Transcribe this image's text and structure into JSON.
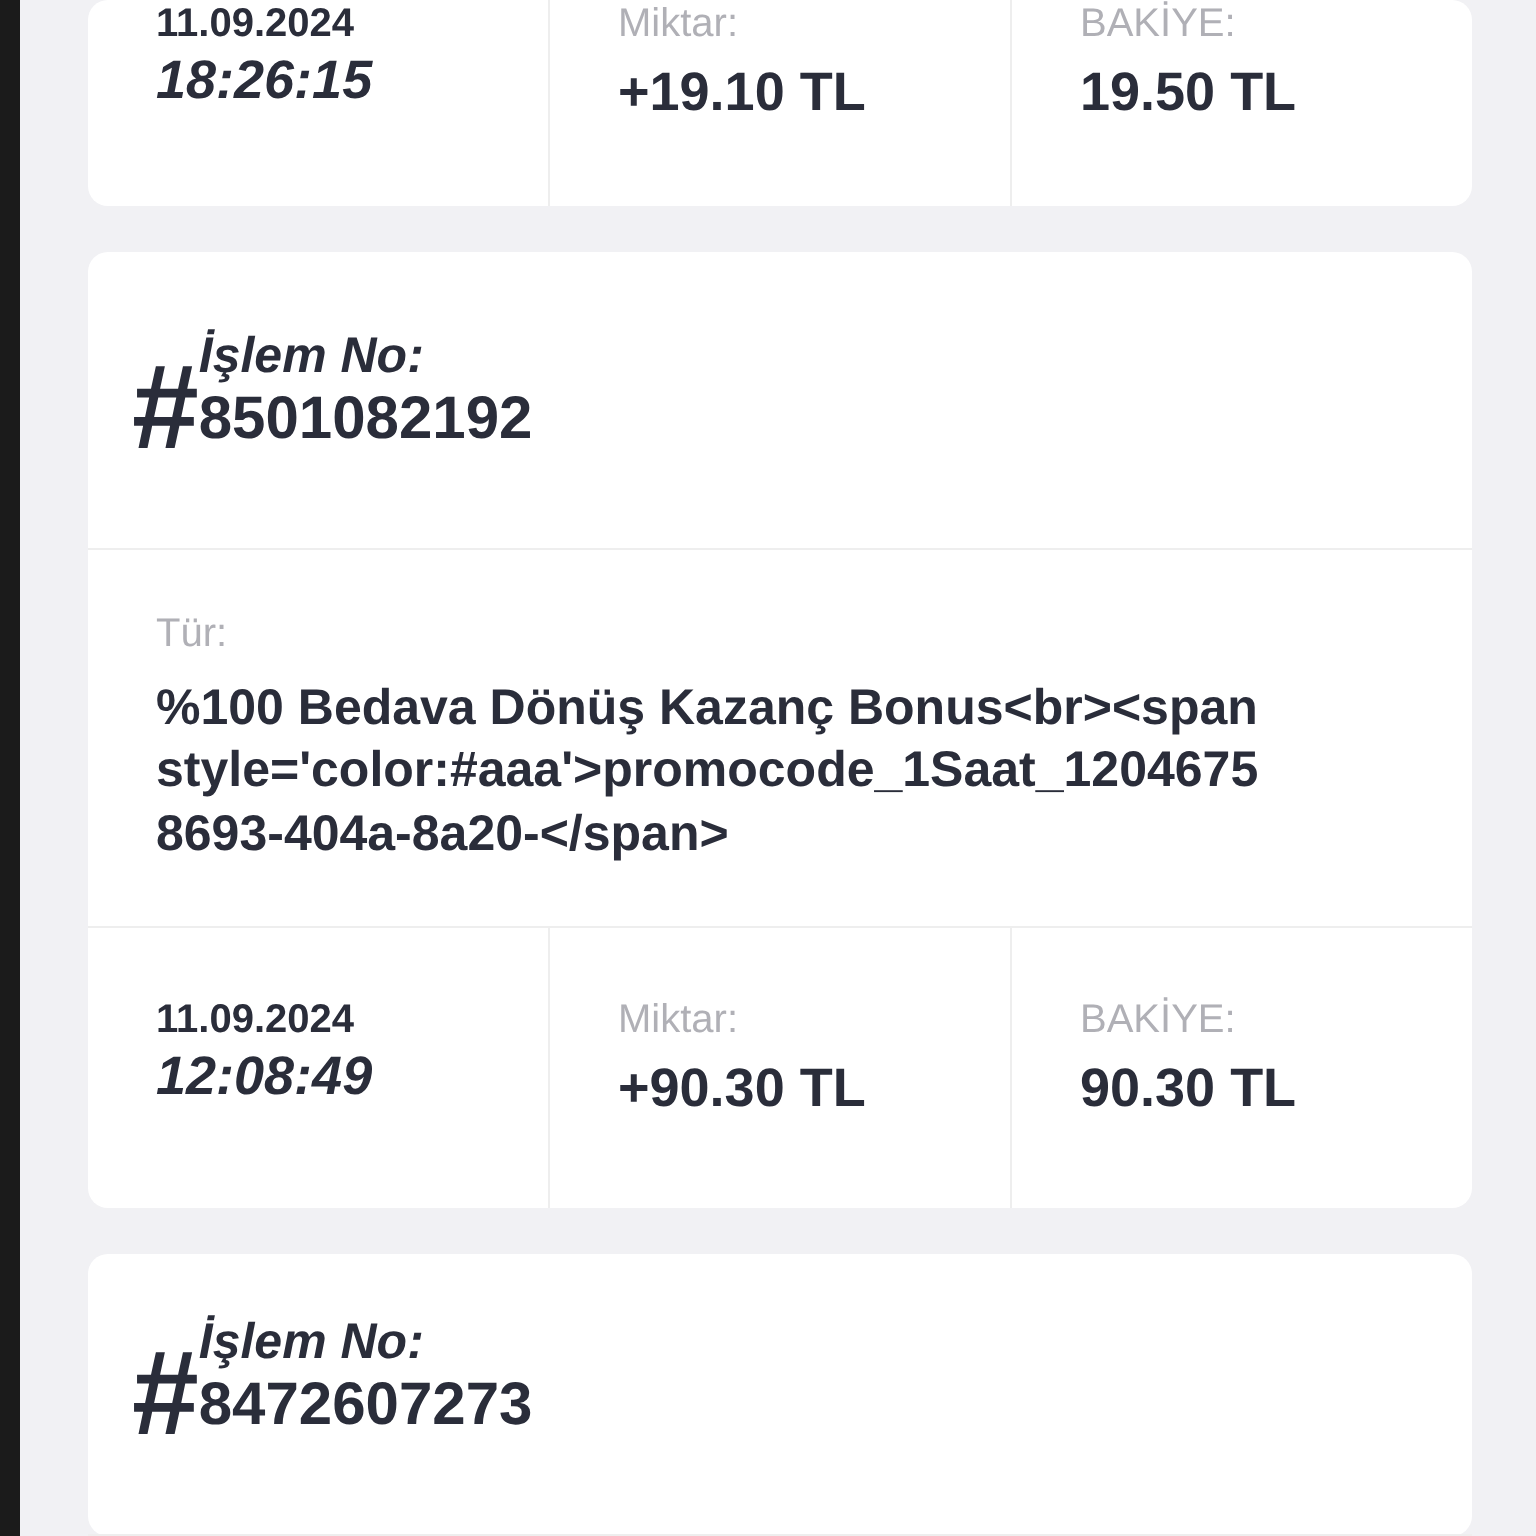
{
  "cards": [
    {
      "date": "11.09.2024",
      "time": "18:26:15",
      "amount_label": "Miktar:",
      "amount": "+19.10 TL",
      "balance_label": "BAKİYE:",
      "balance": "19.50 TL"
    },
    {
      "hash": "#",
      "id_label": "İşlem No:",
      "id": "8501082192",
      "type_label": "Tür:",
      "type_lines": [
        "%100 Bedava Dönüş Kazanç Bonus<br><span",
        "style='color:#aaa'>promocode_1Saat_1204675",
        "8693-404a-8a20-</span>"
      ],
      "date": "11.09.2024",
      "time": "12:08:49",
      "amount_label": "Miktar:",
      "amount": "+90.30 TL",
      "balance_label": "BAKİYE:",
      "balance": "90.30 TL"
    },
    {
      "hash": "#",
      "id_label": "İşlem No:",
      "id": "8472607273"
    }
  ]
}
